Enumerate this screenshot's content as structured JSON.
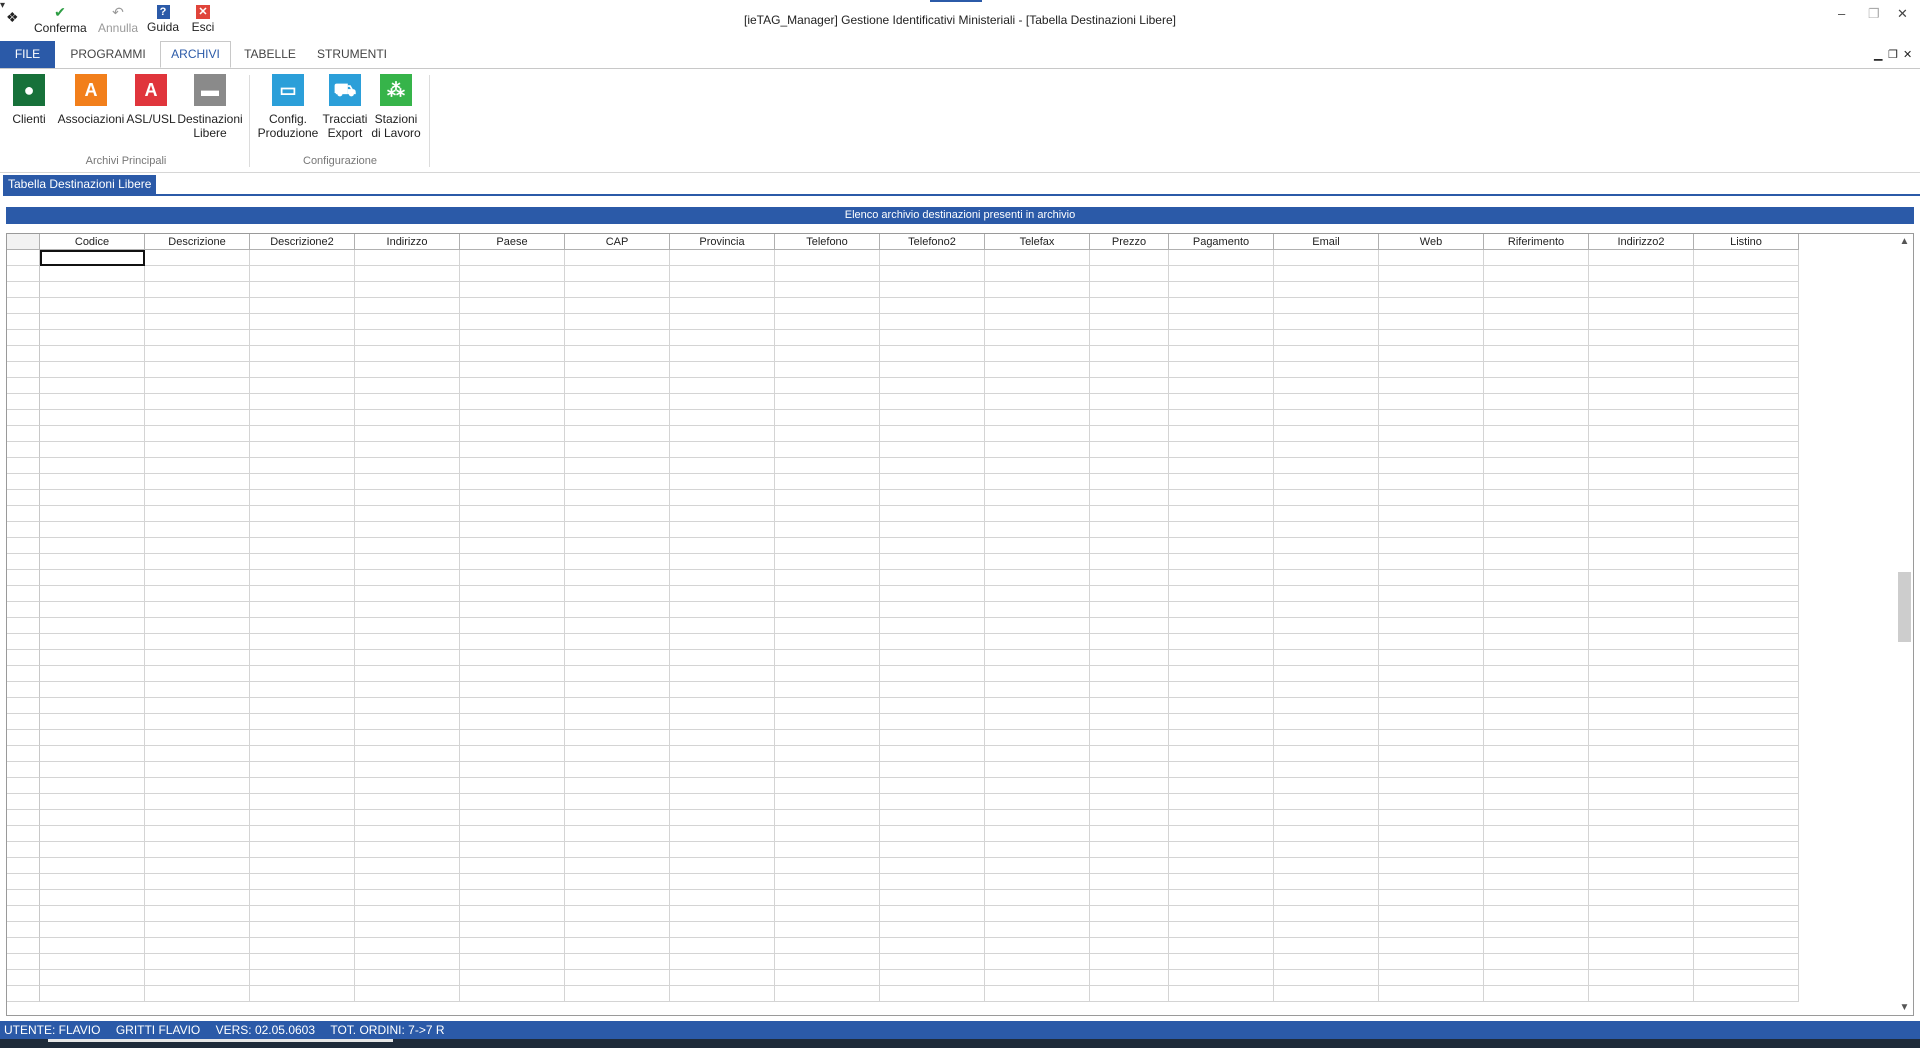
{
  "window": {
    "title": "[ieTAG_Manager] Gestione Identificativi Ministeriali - [Tabella Destinazioni Libere]",
    "min": "–",
    "max": "❐",
    "close": "✕"
  },
  "quick_access": {
    "confirm": "Conferma",
    "undo": "Annulla",
    "help": "Guida",
    "exit": "Esci",
    "more": "▾"
  },
  "tabs": [
    "FILE",
    "PROGRAMMI",
    "ARCHIVI",
    "TABELLE",
    "STRUMENTI"
  ],
  "active_tab": "ARCHIVI",
  "ribbon": {
    "groups": [
      {
        "label": "Archivi Principali",
        "buttons": [
          {
            "label": "Clienti",
            "icon": "person-icon"
          },
          {
            "label": "Associazioni",
            "icon": "association-icon"
          },
          {
            "label": "ASL/USL",
            "icon": "asl-icon"
          },
          {
            "label": "Destinazioni\nLibere",
            "icon": "destination-icon"
          }
        ]
      },
      {
        "label": "Configurazione",
        "buttons": [
          {
            "label": "Config.\nProduzione",
            "icon": "monitor-icon"
          },
          {
            "label": "Tracciati\nExport",
            "icon": "truck-icon"
          },
          {
            "label": "Stazioni\ndi Lavoro",
            "icon": "network-icon"
          }
        ]
      }
    ]
  },
  "document_tab": "Tabella Destinazioni Libere",
  "panel_title": "Elenco archivio destinazioni presenti in archivio",
  "grid": {
    "columns": [
      "Codice",
      "Descrizione",
      "Descrizione2",
      "Indirizzo",
      "Paese",
      "CAP",
      "Provincia",
      "Telefono",
      "Telefono2",
      "Telefax",
      "Prezzo",
      "Pagamento",
      "Email",
      "Web",
      "Riferimento",
      "Indirizzo2",
      "Listino"
    ]
  },
  "status": {
    "user": "UTENTE: FLAVIO",
    "name": "GRITTI FLAVIO",
    "version": "VERS: 02.05.0603",
    "orders": "TOT. ORDINI: 7->7 R"
  },
  "colors": {
    "accent": "#2b5aa8",
    "clienti": "#17713a",
    "associazioni": "#f27f1b",
    "asl": "#e0353c",
    "destinazioni": "#8a8a8a",
    "config": "#2b9fd9",
    "stazioni": "#36b44a"
  }
}
